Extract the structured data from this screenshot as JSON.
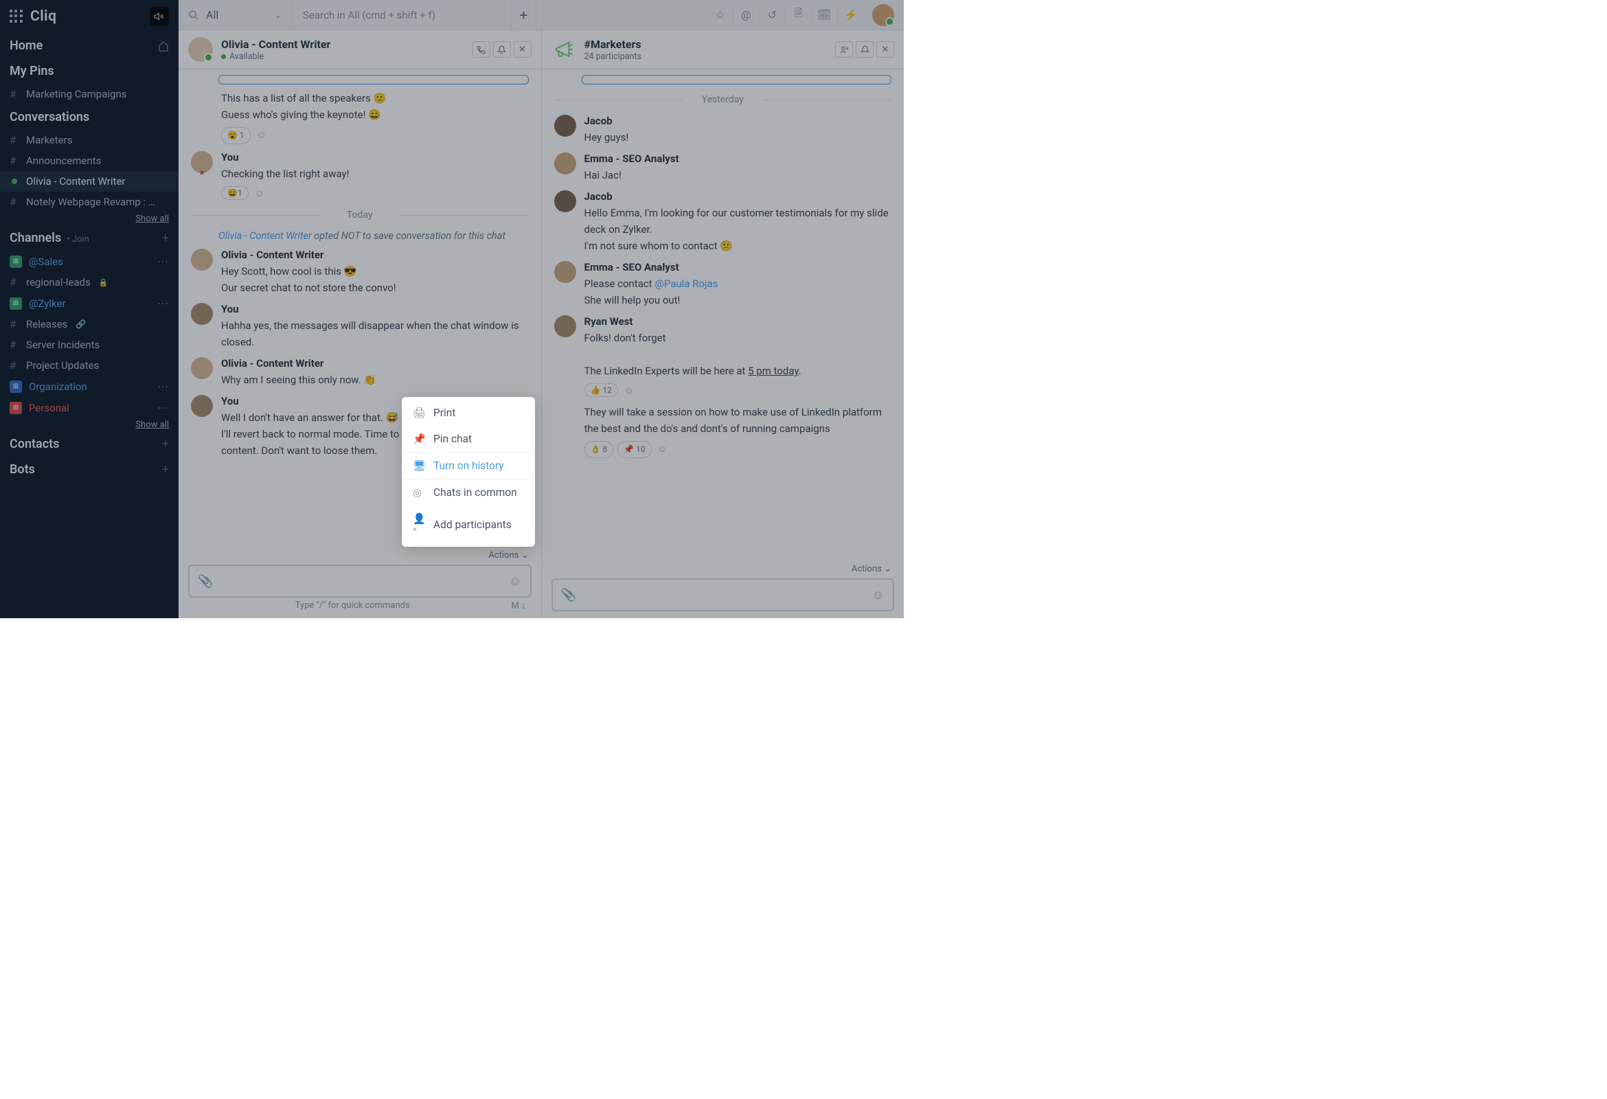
{
  "brand": "Cliq",
  "sidebar": {
    "home": "Home",
    "my_pins": "My Pins",
    "pins": [
      "Marketing Campaigns"
    ],
    "conversations_label": "Conversations",
    "conversations": [
      {
        "label": "Marketers",
        "type": "hash"
      },
      {
        "label": "Announcements",
        "type": "hash"
      },
      {
        "label": "Olivia - Content Writer",
        "type": "dot",
        "active": true
      },
      {
        "label": "Notely Webpage Revamp : …",
        "type": "hash"
      }
    ],
    "show_all": "Show all",
    "channels_label": "Channels",
    "channels_join": "Join",
    "channels": [
      {
        "label": "@Sales",
        "color": "blue",
        "badge": "#2e9e6b"
      },
      {
        "label": "regional-leads",
        "lock": true
      },
      {
        "label": "@Zylker",
        "color": "blue",
        "badge": "#2e9e6b"
      },
      {
        "label": "Releases",
        "link": true
      },
      {
        "label": "Server Incidents"
      },
      {
        "label": "Project Updates"
      },
      {
        "label": "Organization",
        "color": "blue",
        "badge": "#3568c4"
      },
      {
        "label": "Personal",
        "color": "red",
        "badge": "#d94b4b"
      }
    ],
    "contacts": "Contacts",
    "bots": "Bots"
  },
  "topbar": {
    "scope": "All",
    "search_placeholder": "Search in All (cmd + shift + f)"
  },
  "left_chat": {
    "title": "Olivia - Content Writer",
    "status": "Available",
    "messages": [
      {
        "type": "attach"
      },
      {
        "type": "text_cont",
        "lines": [
          "This has a list of all the speakers  🙂",
          "Guess who's giving the keynote!  😄"
        ],
        "reactions": [
          {
            "emoji": "😮",
            "count": "1"
          }
        ]
      },
      {
        "type": "msg",
        "author": "You",
        "star": true,
        "lines": [
          "Checking  the list right away!"
        ],
        "reactions": [
          {
            "emoji": "😀",
            "count": "1"
          }
        ]
      },
      {
        "type": "divider",
        "label": "Today"
      },
      {
        "type": "system",
        "author": "Olivia - Content Writer",
        "text": " opted NOT to save conversation for this chat"
      },
      {
        "type": "msg",
        "author": "Olivia - Content Writer",
        "avatar": "a1",
        "lines": [
          "Hey Scott, how cool is this  😎",
          "Our secret chat to not store the convo!"
        ]
      },
      {
        "type": "msg",
        "author": "You",
        "avatar": "a2",
        "lines": [
          "Hahha yes, the messages will disappear when the chat window is closed."
        ]
      },
      {
        "type": "msg",
        "author": "Olivia - Content Writer",
        "avatar": "a1",
        "lines": [
          "Why am I seeing this only now.  👏"
        ]
      },
      {
        "type": "msg",
        "author": "You",
        "avatar": "a2",
        "lines": [
          "Well I don't have an answer for that.  😅",
          "I'll revert back to normal mode. Time to discuss on important content. Don't want to loose them."
        ]
      }
    ],
    "actions_label": "Actions",
    "compose_hint": "Type \"/\" for quick commands",
    "compose_right": "M ↓"
  },
  "right_chat": {
    "title": "#Marketers",
    "sub": "24 participants",
    "divider": "Yesterday",
    "messages": [
      {
        "author": "Jacob",
        "avatar": "a3",
        "lines": [
          "Hey guys!"
        ]
      },
      {
        "author": "Emma - SEO Analyst",
        "avatar": "a4",
        "lines": [
          "Hai Jac!"
        ]
      },
      {
        "author": "Jacob",
        "avatar": "a3",
        "lines": [
          "Hello Emma, I'm looking for our customer testimonials for my slide deck on Zylker.",
          " I'm not sure whom to contact  😕"
        ]
      },
      {
        "author": "Emma - SEO Analyst",
        "avatar": "a4",
        "lines_html": [
          "Please contact <span class='mention'>@Paula Rojas</span>",
          " She will help you out!"
        ]
      },
      {
        "author": "Ryan West",
        "avatar": "a2",
        "lines_html": [
          "Folks! don't forget",
          "&nbsp;",
          "The LinkedIn Experts will be here at <span class='underline'>5 pm today</span>."
        ],
        "reactions": [
          {
            "emoji": "👍",
            "count": "12"
          }
        ]
      },
      {
        "cont": true,
        "lines": [
          "They will take a session on how to make use of LinkedIn platform the best and the do's and dont's of running campaigns"
        ],
        "reactions": [
          {
            "emoji": "👌",
            "count": "8"
          },
          {
            "emoji": "📌",
            "count": "10"
          }
        ]
      }
    ],
    "actions_label": "Actions"
  },
  "ctx": {
    "items": [
      {
        "icon": "🖨",
        "label": "Print"
      },
      {
        "icon": "📌",
        "label": "Pin chat"
      },
      {
        "icon": "🖥",
        "label": "Turn on history",
        "blue": true
      },
      {
        "icon": "◎",
        "label": "Chats in common"
      },
      {
        "icon": "👤⁺",
        "label": "Add participants"
      }
    ]
  }
}
